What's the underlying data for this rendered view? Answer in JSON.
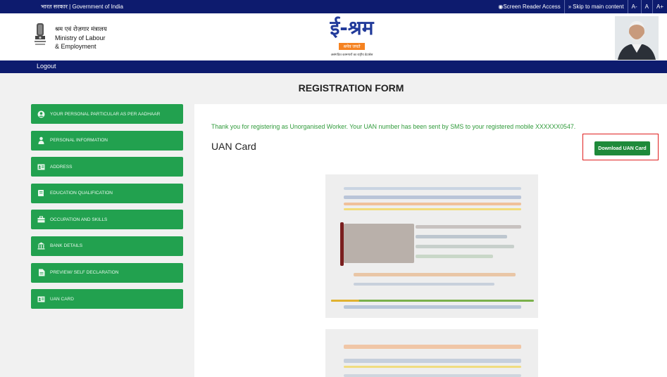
{
  "topbar": {
    "gov_label": "भारत सरकार | Government of India",
    "screen_reader": "Screen Reader Access",
    "skip_main": "Skip to main content",
    "font_small": "A-",
    "font_normal": "A",
    "font_large": "A+"
  },
  "header": {
    "ministry_hi": "श्रम एवं रोज़गार मंत्रालय",
    "ministry_line1": "Ministry of Labour",
    "ministry_line2": "& Employment",
    "logo_text": "ई-श्रम",
    "logo_tag1": "श्रमेव जयते",
    "logo_tag2": "असंगठित कामगारों का राष्ट्रीय डेटाबेस"
  },
  "nav": {
    "logout": "Logout"
  },
  "form": {
    "title": "REGISTRATION FORM"
  },
  "steps": [
    {
      "label": "YOUR PERSONAL PARTICULAR AS PER AADHAAR",
      "icon": "user-circle-icon"
    },
    {
      "label": "PERSONAL INFORMATION",
      "icon": "person-icon"
    },
    {
      "label": "ADDRESS",
      "icon": "id-card-icon"
    },
    {
      "label": "EDUCATION QUALIFICATION",
      "icon": "book-icon"
    },
    {
      "label": "OCCUPATION AND SKILLS",
      "icon": "briefcase-icon"
    },
    {
      "label": "BANK DETAILS",
      "icon": "bank-icon"
    },
    {
      "label": "PREVIEW/ SELF DECLARATION",
      "icon": "document-icon"
    },
    {
      "label": "UAN CARD",
      "icon": "id-card-icon"
    }
  ],
  "main": {
    "thanks": "Thank you for registering as Unorganised Worker. Your UAN number has been sent by SMS to your registered mobile XXXXXX0547.",
    "uan_title": "UAN Card",
    "download_label": "Download UAN Card"
  },
  "colors": {
    "navy": "#0d1b6e",
    "green": "#22a14f",
    "dark_green": "#1e8a3a",
    "highlight_red": "#e02020"
  }
}
